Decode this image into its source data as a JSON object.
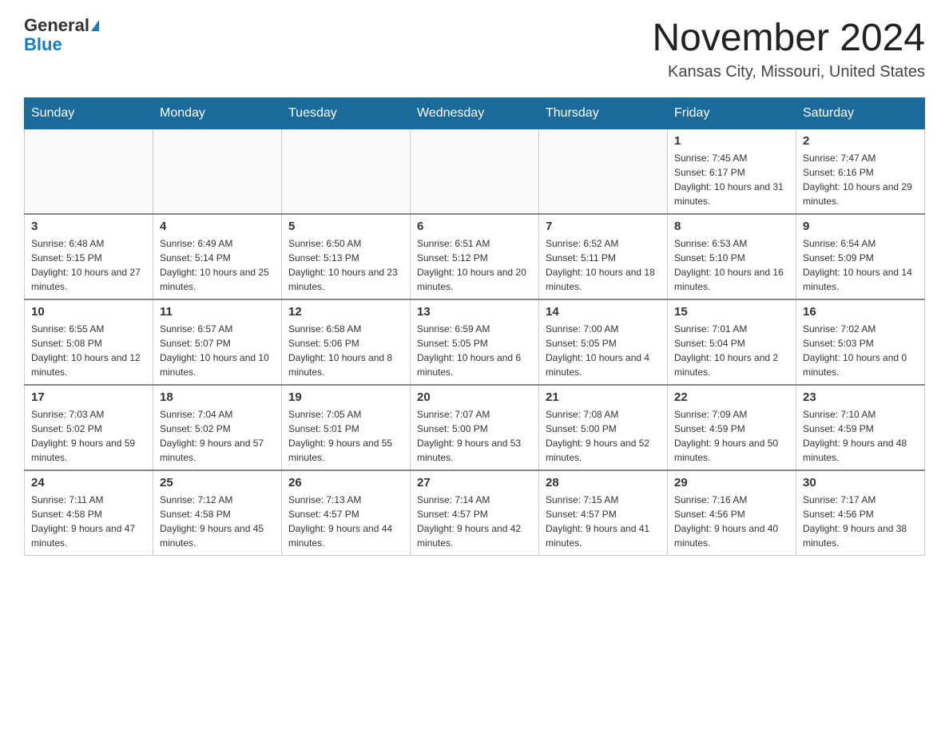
{
  "header": {
    "logo_general": "General",
    "logo_blue": "Blue",
    "month_title": "November 2024",
    "location": "Kansas City, Missouri, United States"
  },
  "weekdays": [
    "Sunday",
    "Monday",
    "Tuesday",
    "Wednesday",
    "Thursday",
    "Friday",
    "Saturday"
  ],
  "weeks": [
    [
      {
        "day": "",
        "sunrise": "",
        "sunset": "",
        "daylight": ""
      },
      {
        "day": "",
        "sunrise": "",
        "sunset": "",
        "daylight": ""
      },
      {
        "day": "",
        "sunrise": "",
        "sunset": "",
        "daylight": ""
      },
      {
        "day": "",
        "sunrise": "",
        "sunset": "",
        "daylight": ""
      },
      {
        "day": "",
        "sunrise": "",
        "sunset": "",
        "daylight": ""
      },
      {
        "day": "1",
        "sunrise": "Sunrise: 7:45 AM",
        "sunset": "Sunset: 6:17 PM",
        "daylight": "Daylight: 10 hours and 31 minutes."
      },
      {
        "day": "2",
        "sunrise": "Sunrise: 7:47 AM",
        "sunset": "Sunset: 6:16 PM",
        "daylight": "Daylight: 10 hours and 29 minutes."
      }
    ],
    [
      {
        "day": "3",
        "sunrise": "Sunrise: 6:48 AM",
        "sunset": "Sunset: 5:15 PM",
        "daylight": "Daylight: 10 hours and 27 minutes."
      },
      {
        "day": "4",
        "sunrise": "Sunrise: 6:49 AM",
        "sunset": "Sunset: 5:14 PM",
        "daylight": "Daylight: 10 hours and 25 minutes."
      },
      {
        "day": "5",
        "sunrise": "Sunrise: 6:50 AM",
        "sunset": "Sunset: 5:13 PM",
        "daylight": "Daylight: 10 hours and 23 minutes."
      },
      {
        "day": "6",
        "sunrise": "Sunrise: 6:51 AM",
        "sunset": "Sunset: 5:12 PM",
        "daylight": "Daylight: 10 hours and 20 minutes."
      },
      {
        "day": "7",
        "sunrise": "Sunrise: 6:52 AM",
        "sunset": "Sunset: 5:11 PM",
        "daylight": "Daylight: 10 hours and 18 minutes."
      },
      {
        "day": "8",
        "sunrise": "Sunrise: 6:53 AM",
        "sunset": "Sunset: 5:10 PM",
        "daylight": "Daylight: 10 hours and 16 minutes."
      },
      {
        "day": "9",
        "sunrise": "Sunrise: 6:54 AM",
        "sunset": "Sunset: 5:09 PM",
        "daylight": "Daylight: 10 hours and 14 minutes."
      }
    ],
    [
      {
        "day": "10",
        "sunrise": "Sunrise: 6:55 AM",
        "sunset": "Sunset: 5:08 PM",
        "daylight": "Daylight: 10 hours and 12 minutes."
      },
      {
        "day": "11",
        "sunrise": "Sunrise: 6:57 AM",
        "sunset": "Sunset: 5:07 PM",
        "daylight": "Daylight: 10 hours and 10 minutes."
      },
      {
        "day": "12",
        "sunrise": "Sunrise: 6:58 AM",
        "sunset": "Sunset: 5:06 PM",
        "daylight": "Daylight: 10 hours and 8 minutes."
      },
      {
        "day": "13",
        "sunrise": "Sunrise: 6:59 AM",
        "sunset": "Sunset: 5:05 PM",
        "daylight": "Daylight: 10 hours and 6 minutes."
      },
      {
        "day": "14",
        "sunrise": "Sunrise: 7:00 AM",
        "sunset": "Sunset: 5:05 PM",
        "daylight": "Daylight: 10 hours and 4 minutes."
      },
      {
        "day": "15",
        "sunrise": "Sunrise: 7:01 AM",
        "sunset": "Sunset: 5:04 PM",
        "daylight": "Daylight: 10 hours and 2 minutes."
      },
      {
        "day": "16",
        "sunrise": "Sunrise: 7:02 AM",
        "sunset": "Sunset: 5:03 PM",
        "daylight": "Daylight: 10 hours and 0 minutes."
      }
    ],
    [
      {
        "day": "17",
        "sunrise": "Sunrise: 7:03 AM",
        "sunset": "Sunset: 5:02 PM",
        "daylight": "Daylight: 9 hours and 59 minutes."
      },
      {
        "day": "18",
        "sunrise": "Sunrise: 7:04 AM",
        "sunset": "Sunset: 5:02 PM",
        "daylight": "Daylight: 9 hours and 57 minutes."
      },
      {
        "day": "19",
        "sunrise": "Sunrise: 7:05 AM",
        "sunset": "Sunset: 5:01 PM",
        "daylight": "Daylight: 9 hours and 55 minutes."
      },
      {
        "day": "20",
        "sunrise": "Sunrise: 7:07 AM",
        "sunset": "Sunset: 5:00 PM",
        "daylight": "Daylight: 9 hours and 53 minutes."
      },
      {
        "day": "21",
        "sunrise": "Sunrise: 7:08 AM",
        "sunset": "Sunset: 5:00 PM",
        "daylight": "Daylight: 9 hours and 52 minutes."
      },
      {
        "day": "22",
        "sunrise": "Sunrise: 7:09 AM",
        "sunset": "Sunset: 4:59 PM",
        "daylight": "Daylight: 9 hours and 50 minutes."
      },
      {
        "day": "23",
        "sunrise": "Sunrise: 7:10 AM",
        "sunset": "Sunset: 4:59 PM",
        "daylight": "Daylight: 9 hours and 48 minutes."
      }
    ],
    [
      {
        "day": "24",
        "sunrise": "Sunrise: 7:11 AM",
        "sunset": "Sunset: 4:58 PM",
        "daylight": "Daylight: 9 hours and 47 minutes."
      },
      {
        "day": "25",
        "sunrise": "Sunrise: 7:12 AM",
        "sunset": "Sunset: 4:58 PM",
        "daylight": "Daylight: 9 hours and 45 minutes."
      },
      {
        "day": "26",
        "sunrise": "Sunrise: 7:13 AM",
        "sunset": "Sunset: 4:57 PM",
        "daylight": "Daylight: 9 hours and 44 minutes."
      },
      {
        "day": "27",
        "sunrise": "Sunrise: 7:14 AM",
        "sunset": "Sunset: 4:57 PM",
        "daylight": "Daylight: 9 hours and 42 minutes."
      },
      {
        "day": "28",
        "sunrise": "Sunrise: 7:15 AM",
        "sunset": "Sunset: 4:57 PM",
        "daylight": "Daylight: 9 hours and 41 minutes."
      },
      {
        "day": "29",
        "sunrise": "Sunrise: 7:16 AM",
        "sunset": "Sunset: 4:56 PM",
        "daylight": "Daylight: 9 hours and 40 minutes."
      },
      {
        "day": "30",
        "sunrise": "Sunrise: 7:17 AM",
        "sunset": "Sunset: 4:56 PM",
        "daylight": "Daylight: 9 hours and 38 minutes."
      }
    ]
  ]
}
